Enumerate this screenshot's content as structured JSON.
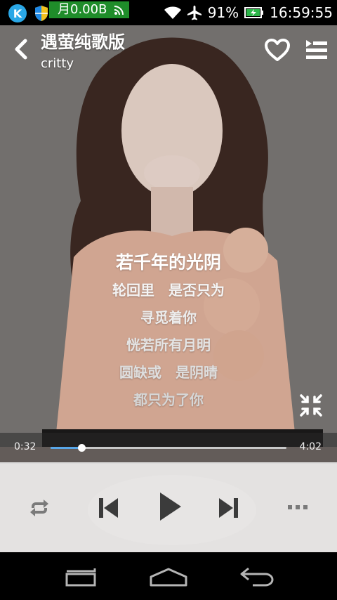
{
  "status_bar": {
    "traffic": "月0.00B",
    "battery_percent": "91%",
    "time": "16:59:55",
    "app_icon_letter": "K",
    "icons": [
      "k-app-icon",
      "shield-icon",
      "wifi-icon",
      "airplane-icon",
      "battery-charging-icon"
    ]
  },
  "header": {
    "title": "遇萤纯歌版",
    "artist": "critty"
  },
  "lyrics": {
    "current": "若千年的光阴",
    "lines": [
      "轮回里　是否只为",
      "寻觅着你",
      "恍若所有月明",
      "圆缺或　是阴晴",
      "都只为了你"
    ]
  },
  "player": {
    "current_time": "0:32",
    "total_time": "4:02",
    "progress": 0.132
  },
  "colors": {
    "progress_fill": "#59a7e8",
    "traffic_badge": "#1f8d2a",
    "control_bar": "#ececec"
  },
  "nav_icons": [
    "recent-apps-icon",
    "home-icon",
    "back-icon"
  ]
}
